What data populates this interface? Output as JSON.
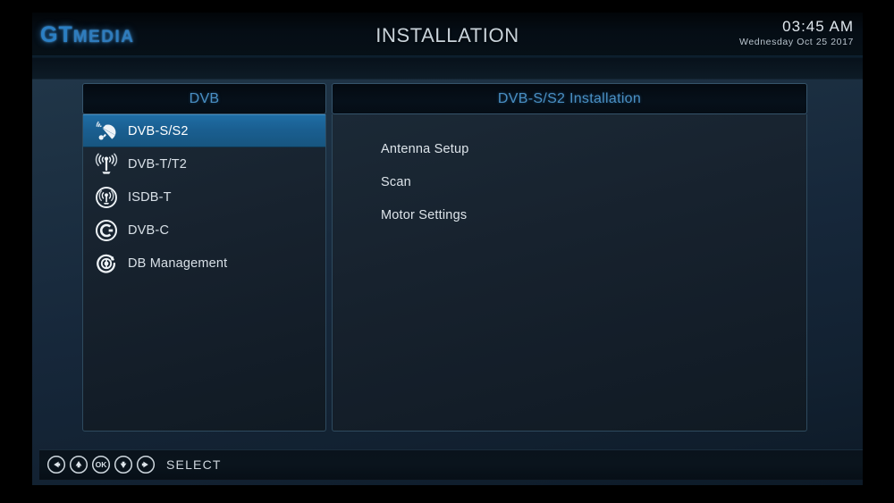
{
  "header": {
    "logo_gt": "GT",
    "logo_media": "MEDIA",
    "title": "INSTALLATION",
    "clock_time": "03:45  AM",
    "clock_date": "Wednesday  Oct  25  2017"
  },
  "left_panel": {
    "title": "DVB",
    "items": [
      {
        "label": "DVB-S/S2",
        "icon": "satellite-dish-icon",
        "selected": true
      },
      {
        "label": "DVB-T/T2",
        "icon": "antenna-tower-icon",
        "selected": false
      },
      {
        "label": "ISDB-T",
        "icon": "signal-circle-icon",
        "selected": false
      },
      {
        "label": "DVB-C",
        "icon": "cable-c-circle-icon",
        "selected": false
      },
      {
        "label": "DB Management",
        "icon": "database-refresh-icon",
        "selected": false
      }
    ]
  },
  "right_panel": {
    "title": "DVB-S/S2 Installation",
    "items": [
      {
        "label": "Antenna Setup"
      },
      {
        "label": "Scan"
      },
      {
        "label": "Motor Settings"
      }
    ]
  },
  "footer": {
    "icons": [
      "arrow-left-icon",
      "arrow-up-icon",
      "ok-icon",
      "arrow-down-icon",
      "arrow-right-icon"
    ],
    "ok_label": "OK",
    "hint": "SELECT"
  },
  "colors": {
    "accent_blue": "#4a90c4",
    "logo_blue": "#2b7fc4",
    "selection_blue": "#1a5f91",
    "text_primary": "#dde4ea",
    "panel_bg": "#17222e"
  }
}
